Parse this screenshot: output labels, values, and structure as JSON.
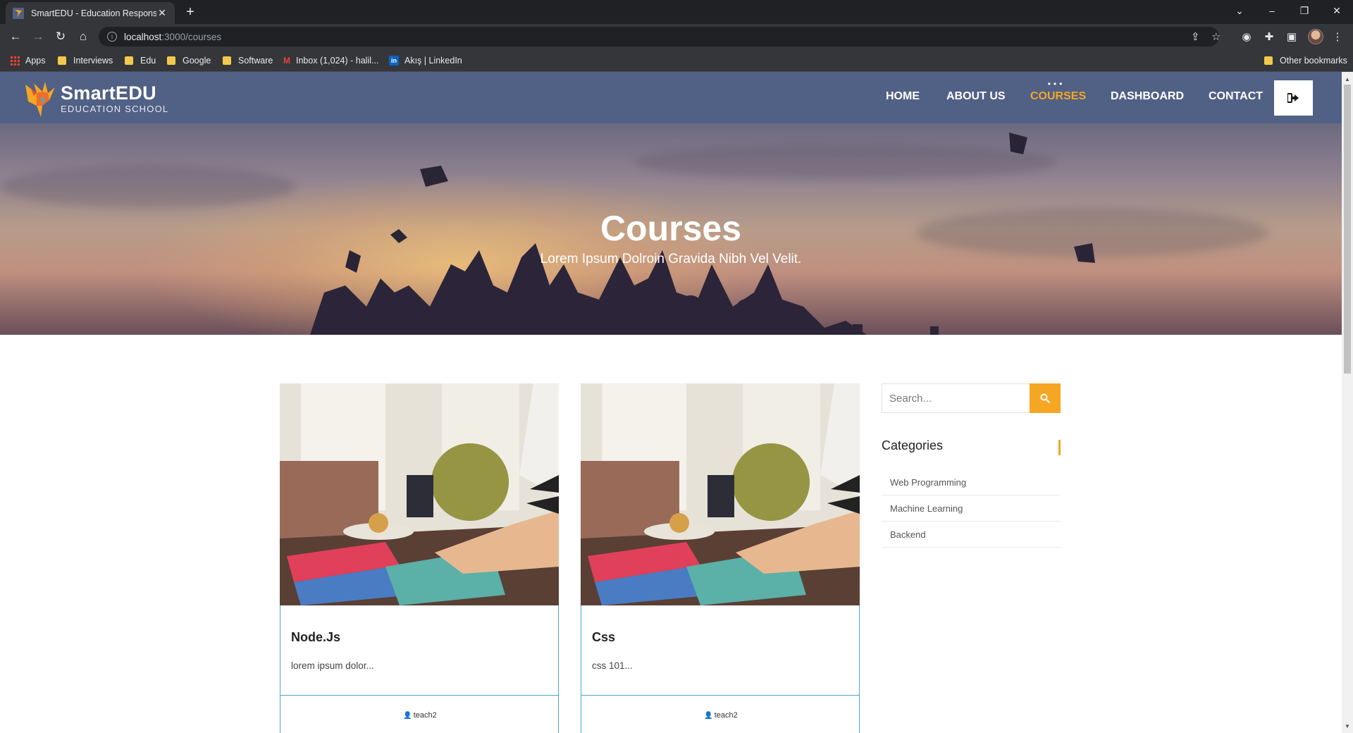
{
  "browser": {
    "tab_title": "SmartEDU - Education Responsive",
    "url_host": "localhost",
    "url_path": ":3000/courses",
    "bookmarks": [
      "Apps",
      "Interviews",
      "Edu",
      "Google",
      "Software",
      "Inbox (1,024) - halil...",
      "Akış | LinkedIn"
    ],
    "other_bookmarks": "Other bookmarks"
  },
  "site": {
    "logo_name": "SmartEDU",
    "logo_sub": "EDUCATION SCHOOL",
    "nav": [
      "HOME",
      "ABOUT US",
      "COURSES",
      "DASHBOARD",
      "CONTACT"
    ],
    "active_nav": "COURSES",
    "accent_color": "#f5a623",
    "header_color": "#516085"
  },
  "hero": {
    "title": "Courses",
    "subtitle": "Lorem Ipsum Dolroin Gravida Nibh Vel Velit."
  },
  "courses": [
    {
      "title": "Node.Js",
      "description": "lorem ipsum dolor...",
      "teacher": "teach2"
    },
    {
      "title": "Css",
      "description": "css 101...",
      "teacher": "teach2"
    }
  ],
  "sidebar": {
    "search_placeholder": "Search...",
    "categories_title": "Categories",
    "categories": [
      "Web Programming",
      "Machine Learning",
      "Backend"
    ]
  }
}
